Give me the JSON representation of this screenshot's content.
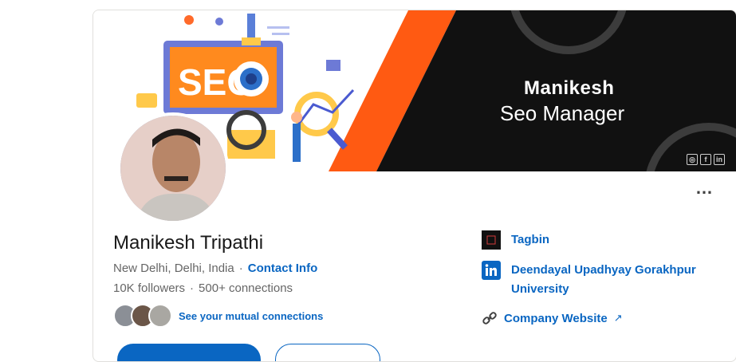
{
  "banner": {
    "name": "Manikesh",
    "role": "Seo Manager",
    "seo_text": "SEO"
  },
  "profile": {
    "name": "Manikesh Tripathi",
    "location": "New Delhi, Delhi, India",
    "location_sep": "·",
    "contact_info": "Contact Info",
    "followers": "10K followers",
    "stats_sep": "·",
    "connections": "500+ connections",
    "mutual": "See your mutual connections"
  },
  "sidebar": {
    "company": "Tagbin",
    "education": "Deendayal Upadhyay Gorakhpur University",
    "website": "Company Website"
  },
  "icons": {
    "more": "more-icon",
    "link": "link-icon",
    "external": "external-link-icon"
  },
  "colors": {
    "accent": "#0a66c2",
    "orange": "#ff5a12",
    "dark": "#111111"
  }
}
